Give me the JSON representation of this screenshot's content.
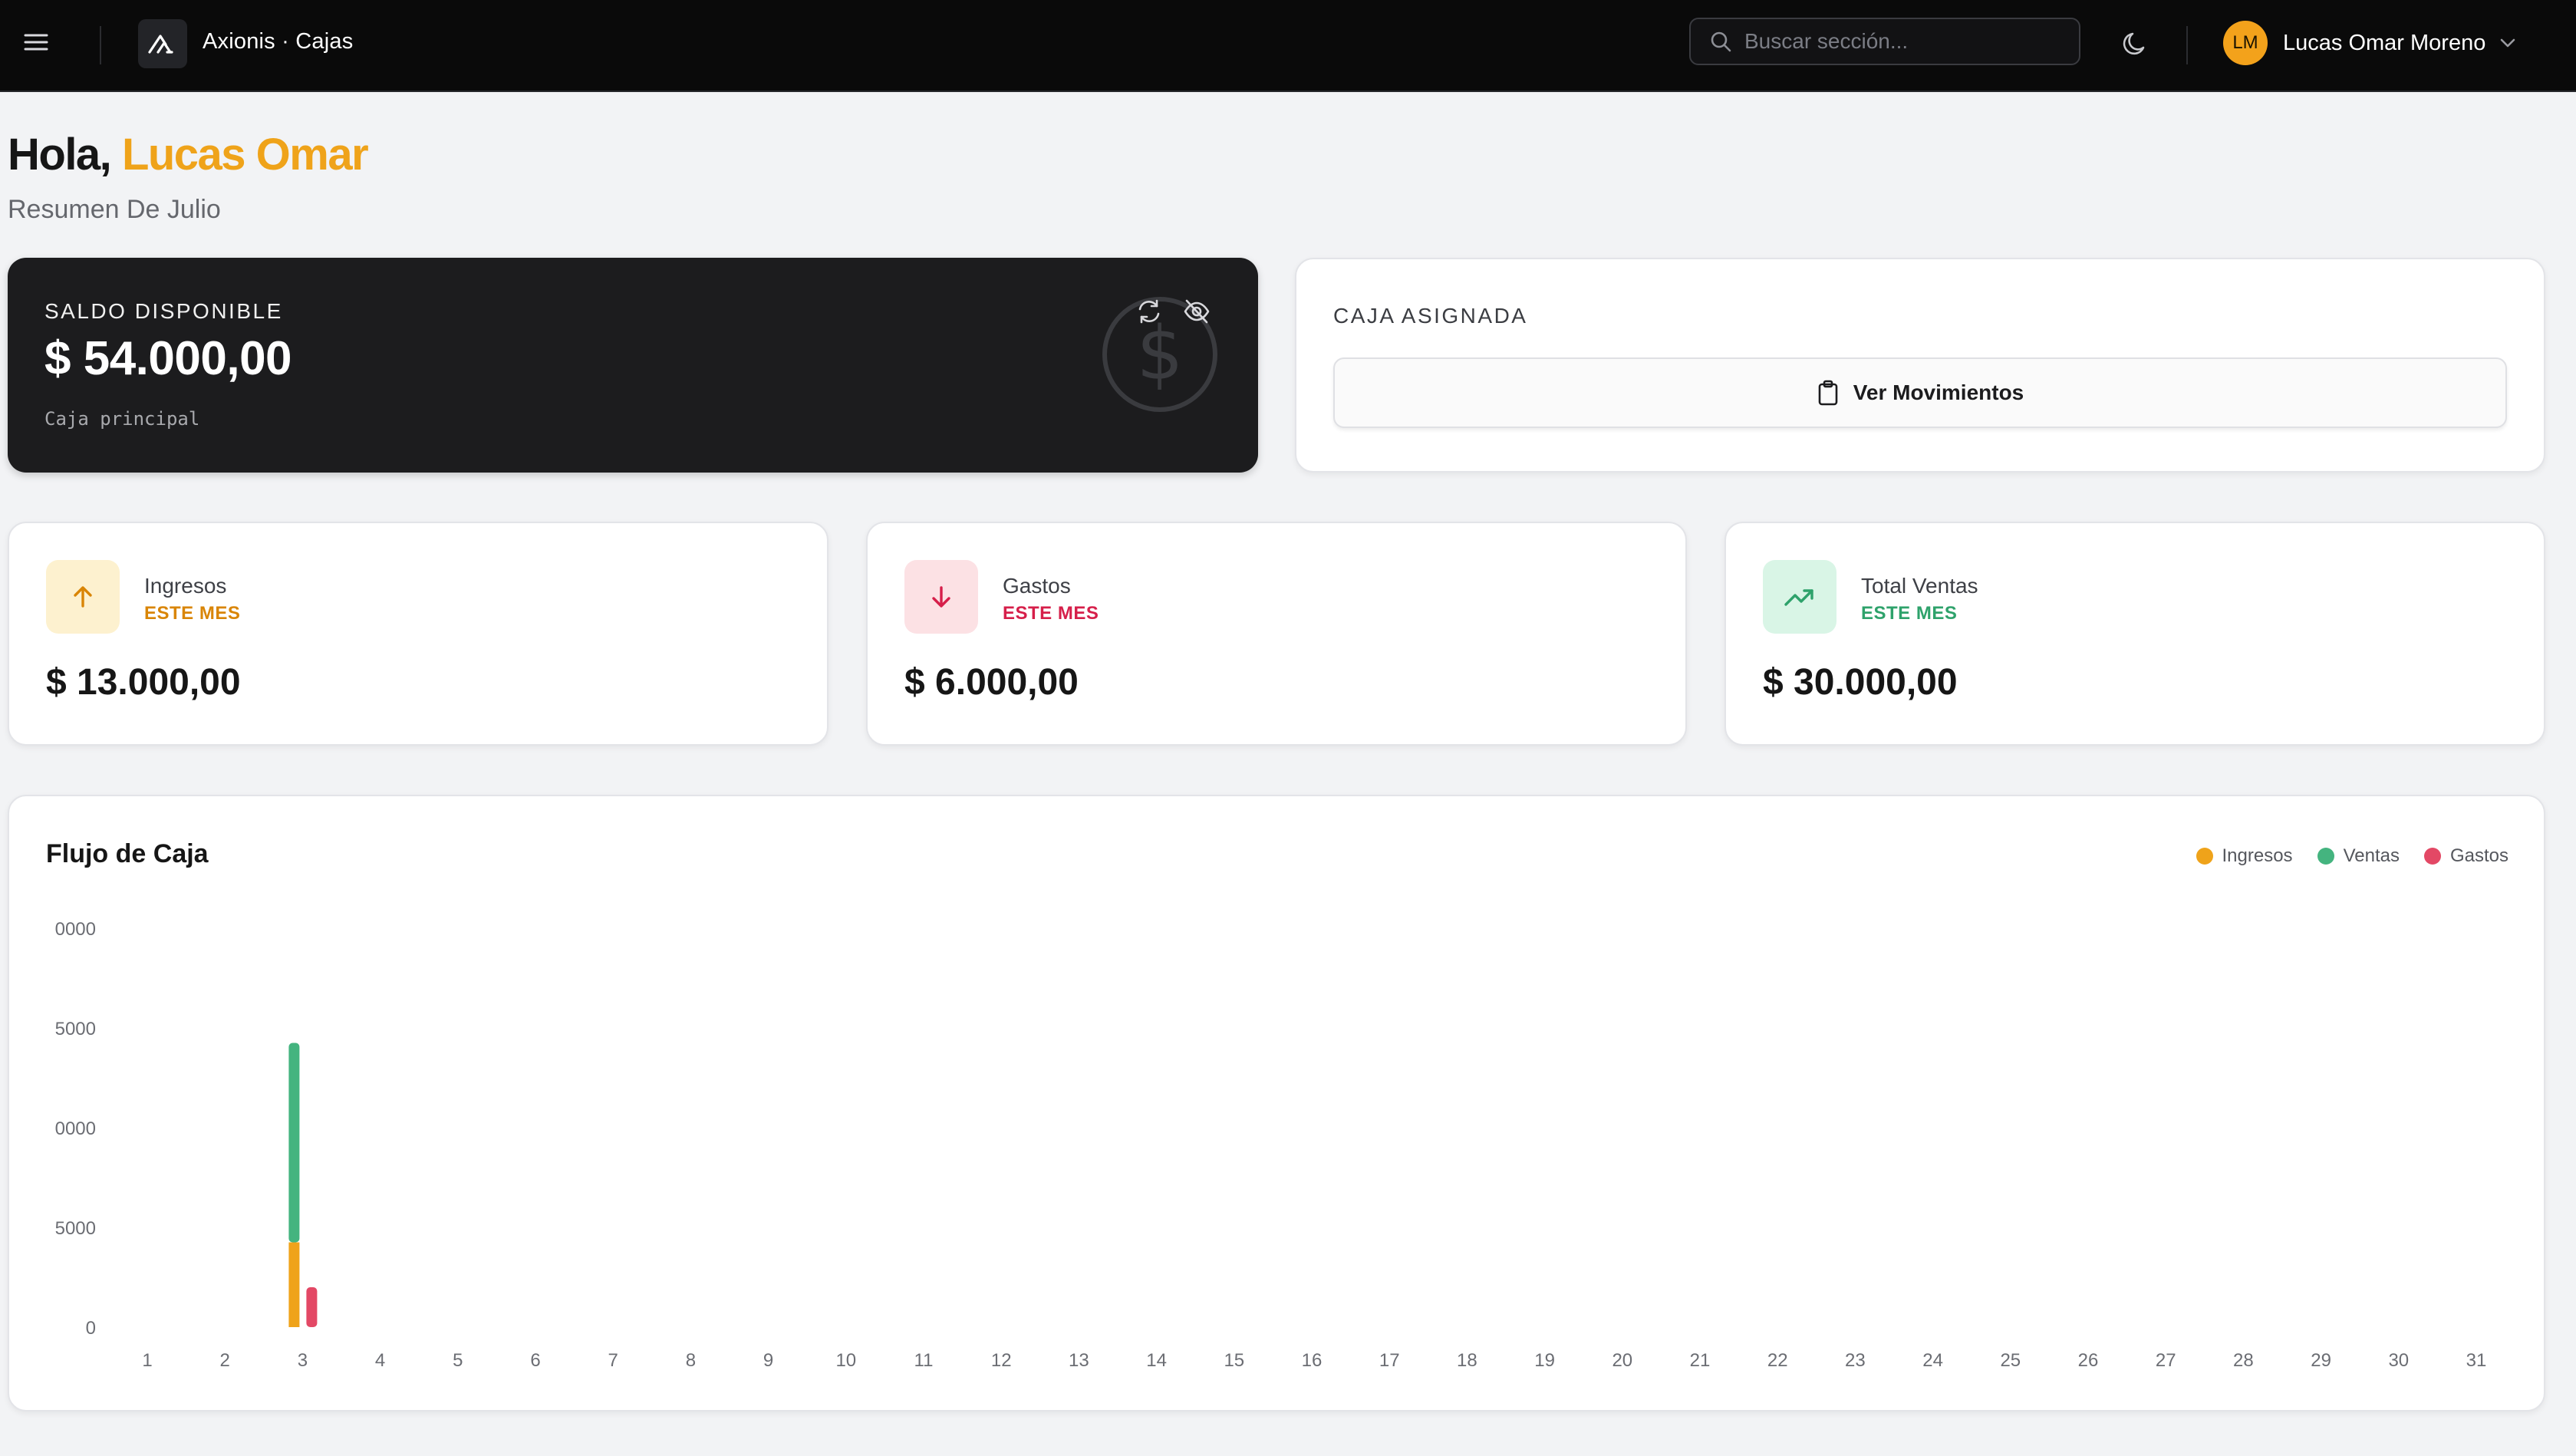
{
  "header": {
    "app_title": "Axionis · Cajas",
    "search_placeholder": "Buscar sección...",
    "user_initials": "LM",
    "user_name": "Lucas Omar Moreno"
  },
  "greeting": {
    "prefix": "Hola,",
    "name": "Lucas Omar",
    "subtitle": "Resumen De Julio"
  },
  "saldo": {
    "label": "SALDO DISPONIBLE",
    "amount": "$ 54.000,00",
    "caja": "Caja principal"
  },
  "caja_asignada": {
    "label": "CAJA ASIGNADA",
    "button_label": "Ver Movimientos"
  },
  "stats": [
    {
      "title": "Ingresos",
      "subtitle": "ESTE MES",
      "amount": "$ 13.000,00",
      "accent": "#d98506",
      "bg": "#fdf1cf",
      "icon": "arrow-up-icon"
    },
    {
      "title": "Gastos",
      "subtitle": "ESTE MES",
      "amount": "$ 6.000,00",
      "accent": "#d61f4a",
      "bg": "#fce1e4",
      "icon": "arrow-down-icon"
    },
    {
      "title": "Total Ventas",
      "subtitle": "ESTE MES",
      "amount": "$ 30.000,00",
      "accent": "#2ea26b",
      "bg": "#d9f5e6",
      "icon": "trending-up-icon"
    }
  ],
  "colors": {
    "ingresos": "#efa31a",
    "ventas": "#44b47f",
    "gastos": "#e34865"
  },
  "chart_data": {
    "type": "bar",
    "title": "Flujo de Caja",
    "x": [
      1,
      2,
      3,
      4,
      5,
      6,
      7,
      8,
      9,
      10,
      11,
      12,
      13,
      14,
      15,
      16,
      17,
      18,
      19,
      20,
      21,
      22,
      23,
      24,
      25,
      26,
      27,
      28,
      29,
      30,
      31
    ],
    "y_tick_labels": [
      "0",
      "5000",
      "0000",
      "5000",
      "0000"
    ],
    "ylim": [
      0,
      40000
    ],
    "series": [
      {
        "name": "Ingresos",
        "stack": "a",
        "values": {
          "3": 8500
        }
      },
      {
        "name": "Ventas",
        "stack": "a",
        "values": {
          "3": 20000
        }
      },
      {
        "name": "Gastos",
        "stack": "b",
        "values": {
          "3": 4000
        }
      }
    ],
    "legend_position": "top-right",
    "grid": false
  }
}
